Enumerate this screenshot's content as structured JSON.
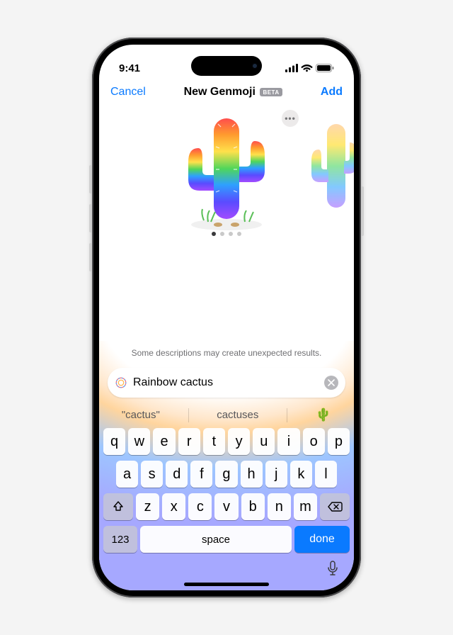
{
  "status": {
    "time": "9:41"
  },
  "nav": {
    "left": "Cancel",
    "title": "New Genmoji",
    "badge": "BETA",
    "right": "Add"
  },
  "hint": "Some descriptions may create unexpected results.",
  "input": {
    "value": "Rainbow cactus"
  },
  "suggestions": {
    "a": "\"cactus\"",
    "b": "cactuses",
    "emoji": "🌵"
  },
  "keyboard": {
    "row1": [
      "q",
      "w",
      "e",
      "r",
      "t",
      "y",
      "u",
      "i",
      "o",
      "p"
    ],
    "row2": [
      "a",
      "s",
      "d",
      "f",
      "g",
      "h",
      "j",
      "k",
      "l"
    ],
    "row3": [
      "z",
      "x",
      "c",
      "v",
      "b",
      "n",
      "m"
    ],
    "numKey": "123",
    "space": "space",
    "done": "done"
  },
  "pager": {
    "count": 4,
    "active": 0
  }
}
